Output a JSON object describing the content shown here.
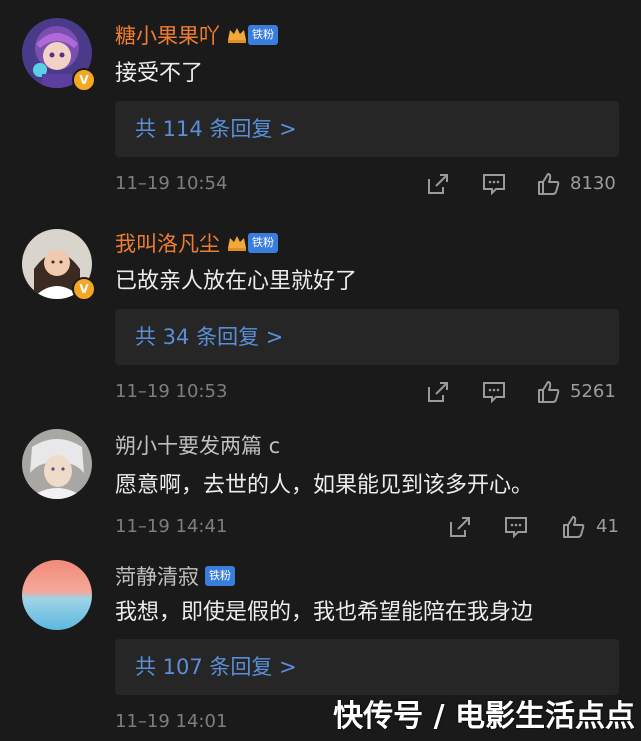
{
  "comments": [
    {
      "username": "糖小果果吖",
      "text": "接受不了",
      "replies": "共 114 条回复 >",
      "time": "11–19 10:54",
      "likes": "8130",
      "fan_badge": "铁粉"
    },
    {
      "username": "我叫洛凡尘",
      "text": "已故亲人放在心里就好了",
      "replies": "共 34 条回复 >",
      "time": "11–19 10:53",
      "likes": "5261",
      "fan_badge": "铁粉"
    },
    {
      "username": "朔小十要发两篇 c",
      "text": "愿意啊，去世的人，如果能见到该多开心。",
      "time": "11–19 14:41",
      "likes": "41"
    },
    {
      "username": "菏静清寂",
      "text": "我想，即使是假的，我也希望能陪在我身边",
      "replies": "共 107 条回复 >",
      "time": "11–19 14:01",
      "fan_badge": "铁粉"
    }
  ],
  "watermark": "快传号 / 电影生活点点",
  "colors": {
    "background": "#1a1a1a",
    "vip_name": "#ef7d2f",
    "reply_link": "#5a8ed8",
    "fan_badge": "#3b7ddd",
    "verified_badge": "#f5a623"
  }
}
